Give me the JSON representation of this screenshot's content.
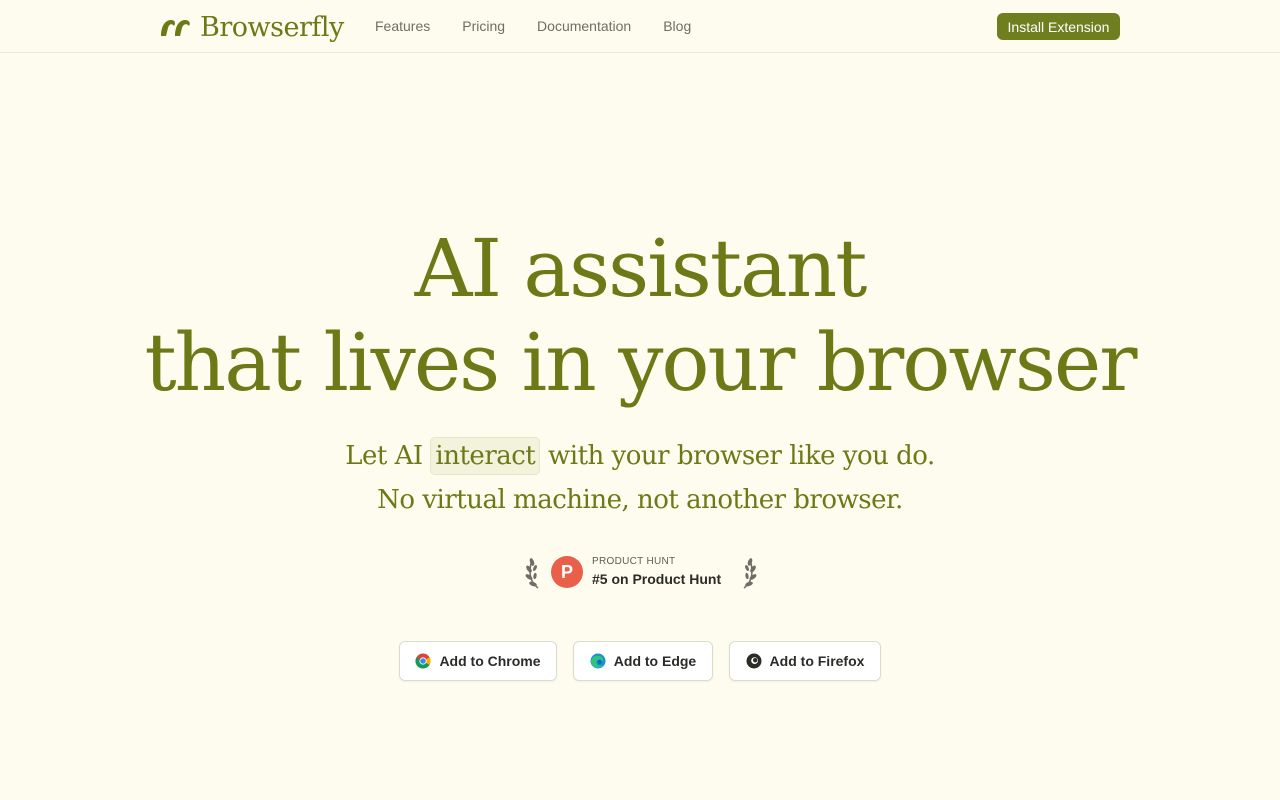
{
  "header": {
    "brand": "Browserfly",
    "nav": [
      "Features",
      "Pricing",
      "Documentation",
      "Blog"
    ],
    "install_label": "Install Extension"
  },
  "hero": {
    "title_line1": "AI assistant",
    "title_line2": "that lives in your browser",
    "sub_line1_pre": "Let AI ",
    "sub_line1_highlight": "interact",
    "sub_line1_post": " with your browser like you do.",
    "sub_line2": "No virtual machine, not another browser."
  },
  "product_hunt": {
    "label": "PRODUCT HUNT",
    "rank": "#5 on Product Hunt",
    "logo_letter": "P"
  },
  "cta": {
    "chrome": "Add to Chrome",
    "edge": "Add to Edge",
    "firefox": "Add to Firefox"
  },
  "colors": {
    "brand_green": "#6b7a17",
    "background": "#fefcee",
    "product_hunt_red": "#e8604a"
  }
}
